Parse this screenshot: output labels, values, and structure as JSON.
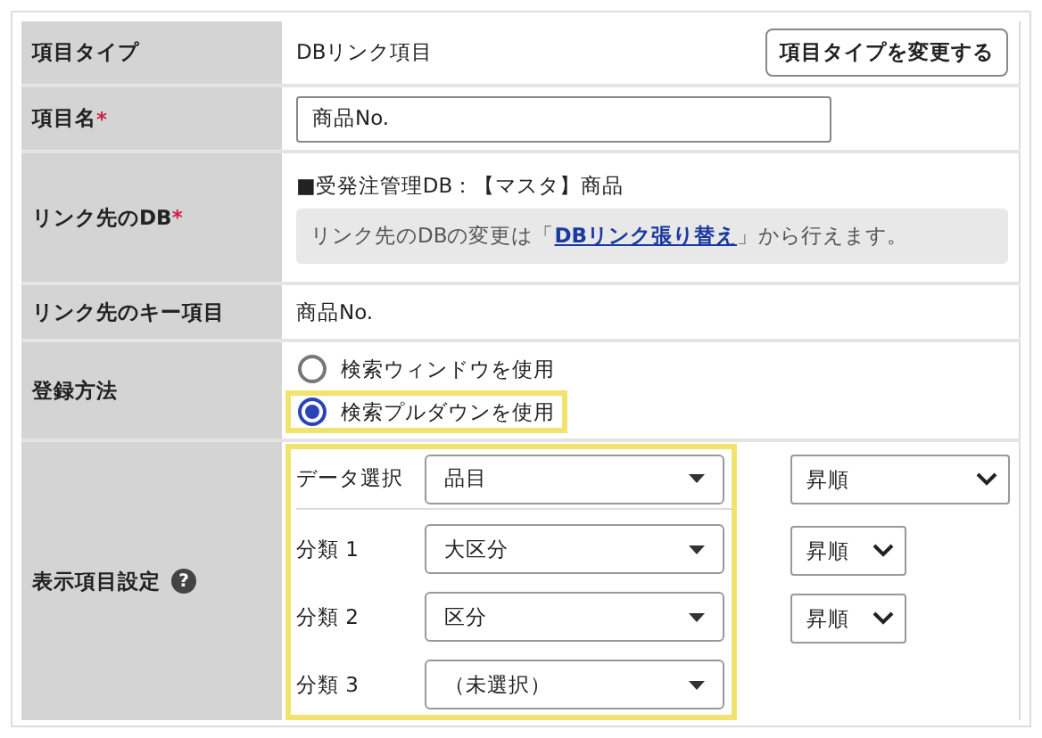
{
  "rows": [
    {
      "kind": "type",
      "label": "項目タイプ",
      "value": "DBリンク項目",
      "button": "項目タイプを変更する"
    },
    {
      "kind": "input",
      "label": "項目名",
      "required_mark": "*",
      "value": "商品No."
    },
    {
      "kind": "db",
      "label": "リンク先のDB",
      "required_mark": "*",
      "value": "■受発注管理DB：【マスタ】商品",
      "note_before": "リンク先のDBの変更は「",
      "note_link": "DBリンク張り替え",
      "note_after": "」から行えます。"
    },
    {
      "kind": "text",
      "label": "リンク先のキー項目",
      "value": "商品No."
    },
    {
      "kind": "radio",
      "label": "登録方法",
      "options": [
        {
          "label": "検索ウィンドウを使用",
          "selected": false,
          "highlighted": false
        },
        {
          "label": "検索プルダウンを使用",
          "selected": true,
          "highlighted": true
        }
      ]
    },
    {
      "kind": "display",
      "label": "表示項目設定",
      "help": "?",
      "highlighted": true,
      "selects": [
        {
          "label": "データ選択",
          "value": "品目",
          "order": "昇順"
        },
        {
          "label": "分類 1",
          "value": "大区分",
          "order": "昇順"
        },
        {
          "label": "分類 2",
          "value": "区分",
          "order": "昇順"
        },
        {
          "label": "分類 3",
          "value": "（未選択）"
        }
      ]
    }
  ]
}
